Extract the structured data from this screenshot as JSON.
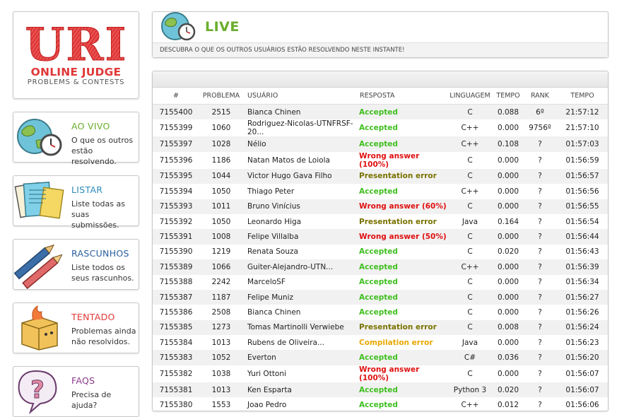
{
  "logo": {
    "main": "URI",
    "line1": "ONLINE JUDGE",
    "line2": "PROBLEMS & CONTESTS"
  },
  "colors": {
    "accepted": "#3fbf1f",
    "wrong": "#e01010",
    "presentation": "#7a7200",
    "compilation": "#e8a800",
    "live": "#6aae2c"
  },
  "menu": [
    {
      "title": "AO VIVO",
      "desc": "O que os outros estão resolvendo.",
      "color": "#6aae2c",
      "icon": "globe-clock-icon"
    },
    {
      "title": "LISTAR",
      "desc": "Liste todas as suas submissões.",
      "color": "#2e8bb8",
      "icon": "papers-icon"
    },
    {
      "title": "RASCUNHOS",
      "desc": "Liste todos os seus rascunhos.",
      "color": "#2a5f9e",
      "icon": "pens-icon"
    },
    {
      "title": "TENTADO",
      "desc": "Problemas ainda não resolvidos.",
      "color": "#e03838",
      "icon": "burning-box-icon"
    },
    {
      "title": "FAQS",
      "desc": "Precisa de ajuda?",
      "color": "#8a3a8a",
      "icon": "question-bubble-icon"
    }
  ],
  "live": {
    "title": "LIVE",
    "description": "DESCUBRA O QUE OS OUTROS USUÁRIOS ESTÃO RESOLVENDO NESTE INSTANTE!"
  },
  "table": {
    "headers": {
      "id": "#",
      "problem": "PROBLEMA",
      "user": "USUÁRIO",
      "answer": "RESPOSTA",
      "language": "LINGUAGEM",
      "time": "TEMPO",
      "rank": "RANK",
      "date": "TEMPO"
    },
    "rows": [
      {
        "id": "7155400",
        "problem": "2515",
        "user": "Bianca Chinen",
        "answer": "Accepted",
        "status": "accepted",
        "language": "C",
        "time": "0.088",
        "rank": "6º",
        "date": "21:57:12"
      },
      {
        "id": "7155399",
        "problem": "1060",
        "user": "Rodriguez-Nicolas-UTNFRSF-20...",
        "answer": "Accepted",
        "status": "accepted",
        "language": "C++",
        "time": "0.000",
        "rank": "9756º",
        "date": "21:57:10"
      },
      {
        "id": "7155397",
        "problem": "1028",
        "user": "Nélio",
        "answer": "Accepted",
        "status": "accepted",
        "language": "C++",
        "time": "0.108",
        "rank": "?",
        "date": "01:57:03"
      },
      {
        "id": "7155396",
        "problem": "1186",
        "user": "Natan Matos de Loiola",
        "answer": "Wrong answer (100%)",
        "status": "wrong",
        "language": "C",
        "time": "0.000",
        "rank": "?",
        "date": "01:56:59"
      },
      {
        "id": "7155395",
        "problem": "1044",
        "user": "Victor Hugo Gava Filho",
        "answer": "Presentation error",
        "status": "presentation",
        "language": "C",
        "time": "0.000",
        "rank": "?",
        "date": "01:56:57"
      },
      {
        "id": "7155394",
        "problem": "1050",
        "user": "Thiago Peter",
        "answer": "Accepted",
        "status": "accepted",
        "language": "C++",
        "time": "0.000",
        "rank": "?",
        "date": "01:56:56"
      },
      {
        "id": "7155393",
        "problem": "1011",
        "user": "Bruno Vinícius",
        "answer": "Wrong answer (60%)",
        "status": "wrong",
        "language": "C",
        "time": "0.000",
        "rank": "?",
        "date": "01:56:55"
      },
      {
        "id": "7155392",
        "problem": "1050",
        "user": "Leonardo Higa",
        "answer": "Presentation error",
        "status": "presentation",
        "language": "Java",
        "time": "0.164",
        "rank": "?",
        "date": "01:56:54"
      },
      {
        "id": "7155391",
        "problem": "1008",
        "user": "Felipe Villalba",
        "answer": "Wrong answer (50%)",
        "status": "wrong",
        "language": "C",
        "time": "0.000",
        "rank": "?",
        "date": "01:56:44"
      },
      {
        "id": "7155390",
        "problem": "1219",
        "user": "Renata Souza",
        "answer": "Accepted",
        "status": "accepted",
        "language": "C",
        "time": "0.020",
        "rank": "?",
        "date": "01:56:43"
      },
      {
        "id": "7155389",
        "problem": "1066",
        "user": "Guiter-Alejandro-UTN...",
        "answer": "Accepted",
        "status": "accepted",
        "language": "C++",
        "time": "0.000",
        "rank": "?",
        "date": "01:56:39"
      },
      {
        "id": "7155388",
        "problem": "2242",
        "user": "MarceloSF",
        "answer": "Accepted",
        "status": "accepted",
        "language": "C",
        "time": "0.000",
        "rank": "?",
        "date": "01:56:34"
      },
      {
        "id": "7155387",
        "problem": "1187",
        "user": "Felipe Muniz",
        "answer": "Accepted",
        "status": "accepted",
        "language": "C",
        "time": "0.000",
        "rank": "?",
        "date": "01:56:27"
      },
      {
        "id": "7155386",
        "problem": "2508",
        "user": "Bianca Chinen",
        "answer": "Accepted",
        "status": "accepted",
        "language": "C",
        "time": "0.000",
        "rank": "?",
        "date": "01:56:26"
      },
      {
        "id": "7155385",
        "problem": "1273",
        "user": "Tomas Martinolli Verwiebe",
        "answer": "Presentation error",
        "status": "presentation",
        "language": "C",
        "time": "0.008",
        "rank": "?",
        "date": "01:56:24"
      },
      {
        "id": "7155384",
        "problem": "1013",
        "user": "Rubens de Oliveira...",
        "answer": "Compilation error",
        "status": "compilation",
        "language": "Java",
        "time": "0.000",
        "rank": "?",
        "date": "01:56:23"
      },
      {
        "id": "7155383",
        "problem": "1052",
        "user": "Everton",
        "answer": "Accepted",
        "status": "accepted",
        "language": "C#",
        "time": "0.036",
        "rank": "?",
        "date": "01:56:20"
      },
      {
        "id": "7155382",
        "problem": "1038",
        "user": "Yuri Ottoni",
        "answer": "Wrong answer (100%)",
        "status": "wrong",
        "language": "C",
        "time": "0.000",
        "rank": "?",
        "date": "01:56:07"
      },
      {
        "id": "7155381",
        "problem": "1013",
        "user": "Ken Esparta",
        "answer": "Accepted",
        "status": "accepted",
        "language": "Python 3",
        "time": "0.020",
        "rank": "?",
        "date": "01:56:07"
      },
      {
        "id": "7155380",
        "problem": "1553",
        "user": "Joao Pedro",
        "answer": "Accepted",
        "status": "accepted",
        "language": "C++",
        "time": "0.012",
        "rank": "?",
        "date": "01:56:06"
      }
    ]
  }
}
